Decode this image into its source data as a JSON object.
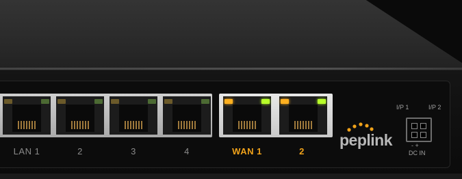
{
  "device": {
    "brand": "peplink",
    "ports": [
      {
        "label": "LAN 1"
      },
      {
        "label": "2"
      },
      {
        "label": "3"
      },
      {
        "label": "4"
      }
    ],
    "wan_ports": [
      {
        "label": "WAN 1"
      },
      {
        "label": "2"
      }
    ],
    "power": {
      "ip1": "I/P 1",
      "ip2": "I/P 2",
      "polarity": "-  +",
      "dc_in": "DC IN"
    },
    "colors": {
      "chassis": "#2a2a2a",
      "wan_accent": "#f0a21a",
      "logo_dots": "#f0a21a",
      "led_amber": "#ffb020",
      "led_green": "#b8ff2a"
    }
  }
}
